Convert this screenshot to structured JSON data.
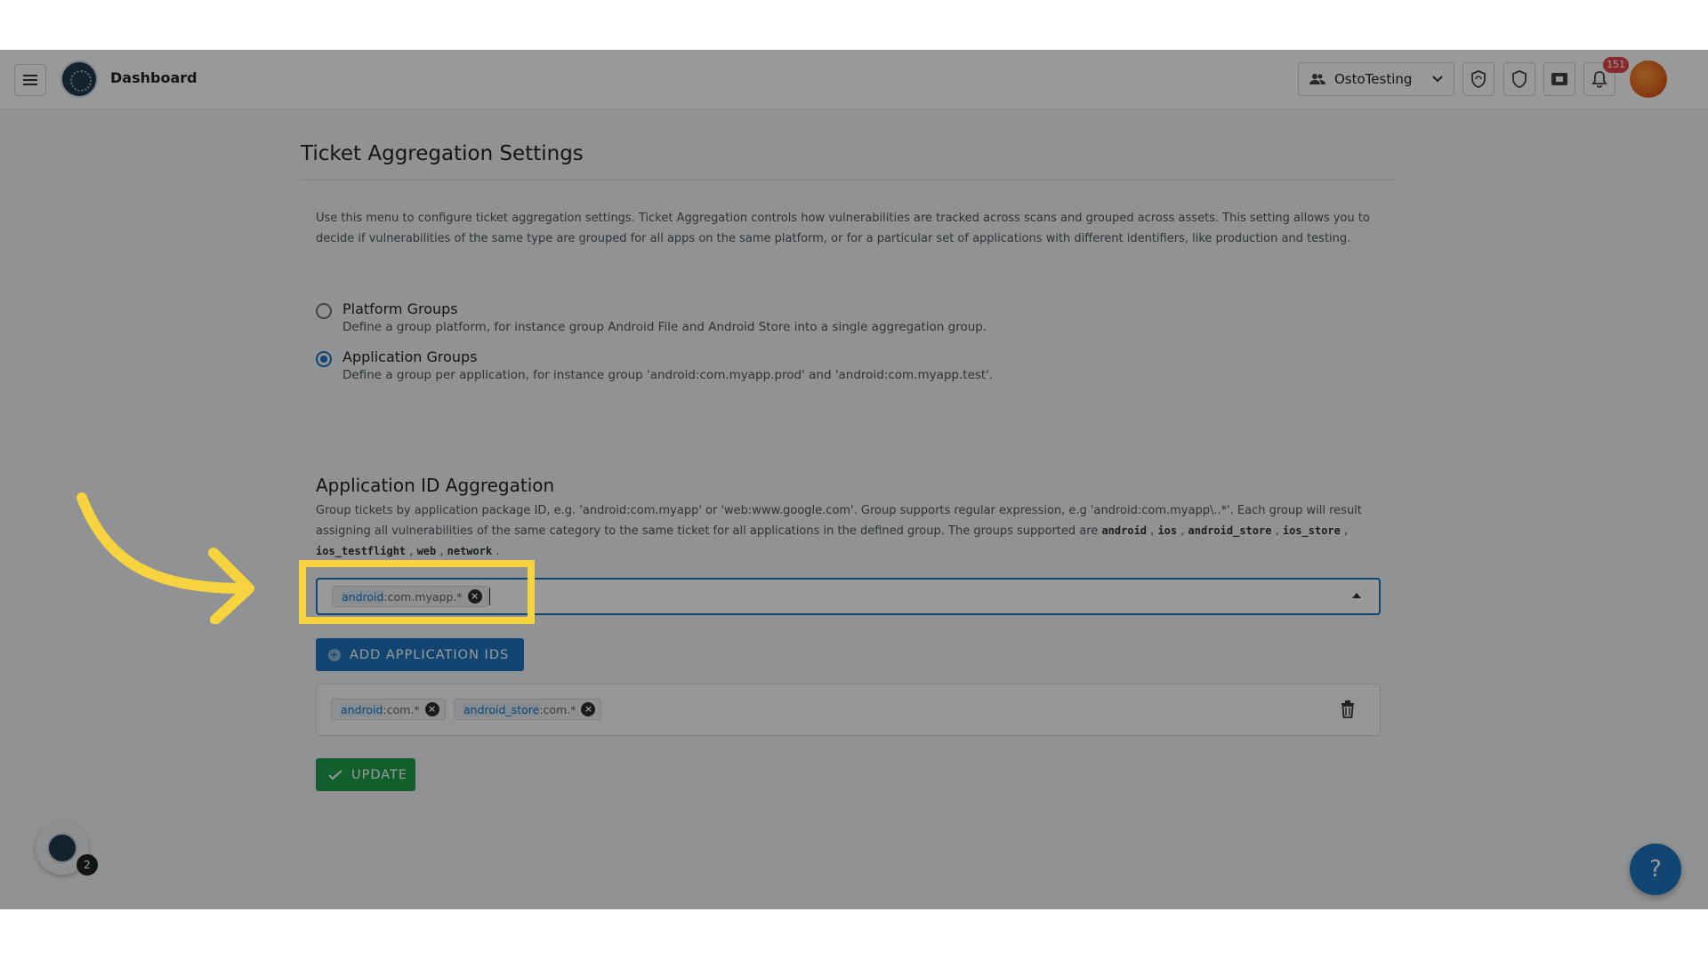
{
  "topbar": {
    "title": "Dashboard",
    "org_name": "OstoTesting",
    "notification_count": "151"
  },
  "page": {
    "title": "Ticket Aggregation Settings",
    "description": "Use this menu to configure ticket aggregation settings. Ticket Aggregation controls how vulnerabilities are tracked across scans and grouped across assets. This setting allows you to decide if vulnerabilities of the same type are grouped for all apps on the same platform, or for a particular set of applications with different identifiers, like production and testing."
  },
  "options": [
    {
      "label": "Platform Groups",
      "description": "Define a group platform, for instance group Android File and Android Store into a single aggregation group.",
      "checked": false
    },
    {
      "label": "Application Groups",
      "description": "Define a group per application, for instance group 'android:com.myapp.prod' and 'android:com.myapp.test'.",
      "checked": true
    }
  ],
  "aggregation": {
    "title": "Application ID Aggregation",
    "description": "Group tickets by application package ID, e.g. 'android:com.myapp' or 'web:www.google.com'. Group supports regular expression, e.g 'android:com.myapp\\..*'. Each group will result assigning all vulnerabilities of the same category to the same ticket for all applications in the defined group. The groups supported are",
    "platforms": [
      "android",
      "ios",
      "android_store",
      "ios_store",
      "ios_testflight",
      "web",
      "network"
    ],
    "input_chip": {
      "platform": "android",
      "pattern": ":com.myapp.*"
    },
    "add_button": "ADD APPLICATION IDS",
    "group_chips": [
      {
        "platform": "android",
        "pattern": ":com.*"
      },
      {
        "platform": "android_store",
        "pattern": ":com.*"
      }
    ],
    "update_button": "UPDATE"
  },
  "widgets": {
    "float_count": "2",
    "help_label": "?"
  },
  "colors": {
    "primary": "#1b75bc",
    "success": "#1f9d4c",
    "highlight": "#f7d43f",
    "badge": "#e5484d"
  }
}
